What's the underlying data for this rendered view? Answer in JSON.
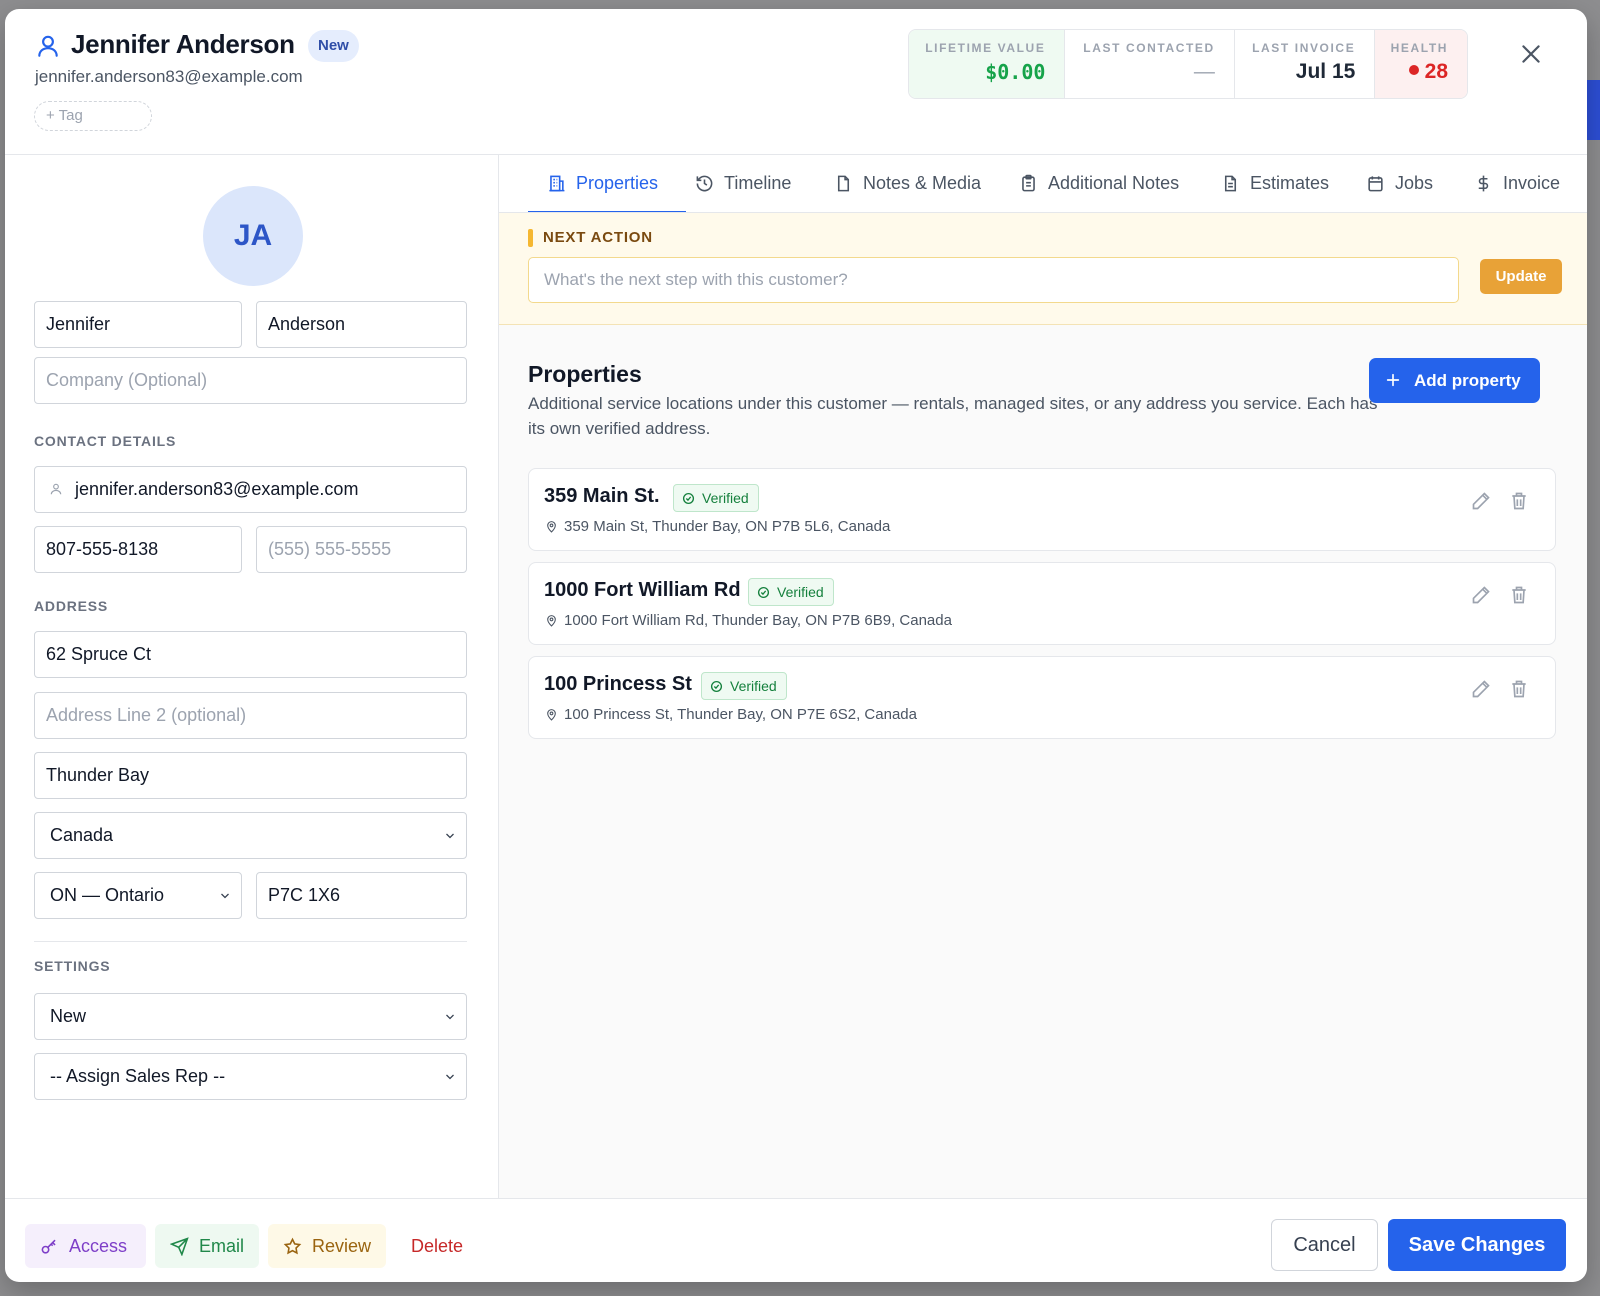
{
  "customer": {
    "name": "Jennifer Anderson",
    "status_badge": "New",
    "email": "jennifer.anderson83@example.com",
    "tag_button": "+ Tag",
    "initials": "JA"
  },
  "stats": {
    "lifetime_value": {
      "label": "LIFETIME VALUE",
      "value": "$0.00"
    },
    "last_contacted": {
      "label": "LAST CONTACTED",
      "value": "—"
    },
    "last_invoice": {
      "label": "LAST INVOICE",
      "value": "Jul 15"
    },
    "health": {
      "label": "HEALTH",
      "value": "28"
    }
  },
  "form": {
    "first_name": "Jennifer",
    "last_name": "Anderson",
    "company_placeholder": "Company (Optional)",
    "contact_section": "CONTACT DETAILS",
    "email": "jennifer.anderson83@example.com",
    "phone": "807-555-8138",
    "phone2_placeholder": "(555) 555-5555",
    "address_section": "ADDRESS",
    "address_line1": "62 Spruce Ct",
    "address_line2_placeholder": "Address Line 2 (optional)",
    "city": "Thunder Bay",
    "country": "Canada",
    "province": "ON — Ontario",
    "postal": "P7C 1X6",
    "settings_section": "SETTINGS",
    "status": "New",
    "sales_rep": "-- Assign Sales Rep --"
  },
  "tabs": [
    {
      "label": "Properties",
      "icon": "building-icon",
      "active": true
    },
    {
      "label": "Timeline",
      "icon": "history-icon"
    },
    {
      "label": "Notes & Media",
      "icon": "file-icon"
    },
    {
      "label": "Additional Notes",
      "icon": "clipboard-icon"
    },
    {
      "label": "Estimates",
      "icon": "document-icon"
    },
    {
      "label": "Jobs",
      "icon": "calendar-icon"
    },
    {
      "label": "Invoice",
      "icon": "dollar-icon"
    }
  ],
  "next_action": {
    "label": "NEXT ACTION",
    "placeholder": "What's the next step with this customer?",
    "button": "Update"
  },
  "properties": {
    "title": "Properties",
    "description": "Additional service locations under this customer — rentals, managed sites, or any address you service. Each has its own verified address.",
    "add_button": "Add property",
    "items": [
      {
        "name": "359 Main St.",
        "badge": "Verified",
        "address": "359 Main St, Thunder Bay, ON P7B 5L6, Canada"
      },
      {
        "name": "1000 Fort William Rd",
        "badge": "Verified",
        "address": "1000 Fort William Rd, Thunder Bay, ON P7B 6B9, Canada"
      },
      {
        "name": "100 Princess St",
        "badge": "Verified",
        "address": "100 Princess St, Thunder Bay, ON P7E 6S2, Canada"
      }
    ]
  },
  "footer": {
    "access": "Access",
    "email": "Email",
    "review": "Review",
    "delete": "Delete",
    "cancel": "Cancel",
    "save": "Save Changes"
  },
  "colors": {
    "primary": "#2563eb",
    "health_bad": "#dc2626",
    "lifetime_green": "#16a34a",
    "next_action_bg": "#fffaeb"
  }
}
